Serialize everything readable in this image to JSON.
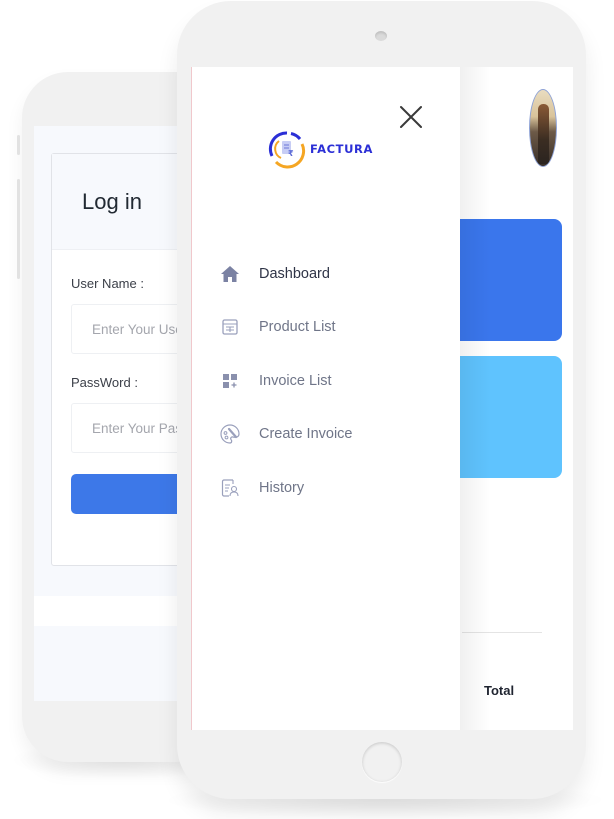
{
  "login_screen": {
    "title": "Log in",
    "username": {
      "label": "User Name :",
      "placeholder": "Enter Your Username",
      "value": ""
    },
    "password": {
      "label": "PassWord :",
      "placeholder": "Enter Your Password",
      "value": ""
    },
    "submit_button": {
      "label": "",
      "color": "#3d78e8"
    }
  },
  "drawer": {
    "brand": {
      "name": "FACTURA",
      "logo_icon": "factura-logo-icon"
    },
    "close_icon": "close-icon",
    "menu": [
      {
        "label": "Dashboard",
        "icon": "home-icon",
        "active": true
      },
      {
        "label": "Product List",
        "icon": "calendar-list-icon",
        "active": false
      },
      {
        "label": "Invoice List",
        "icon": "grid-add-icon",
        "active": false
      },
      {
        "label": "Create Invoice",
        "icon": "palette-brush-icon",
        "active": false
      },
      {
        "label": "History",
        "icon": "document-user-icon",
        "active": false
      }
    ]
  },
  "dashboard": {
    "avatar_icon": "user-avatar",
    "cards": [
      {
        "color": "#3a76ec"
      },
      {
        "color": "#5fc3fe"
      }
    ],
    "table_header": {
      "total": "Total"
    }
  },
  "colors": {
    "accent_blue": "#3d78e8",
    "light_blue": "#5fc3fe",
    "brand_blue": "#2b2fd6",
    "brand_orange": "#f5a623",
    "menu_text": "#6f7588",
    "menu_icon": "#8a90ad"
  }
}
